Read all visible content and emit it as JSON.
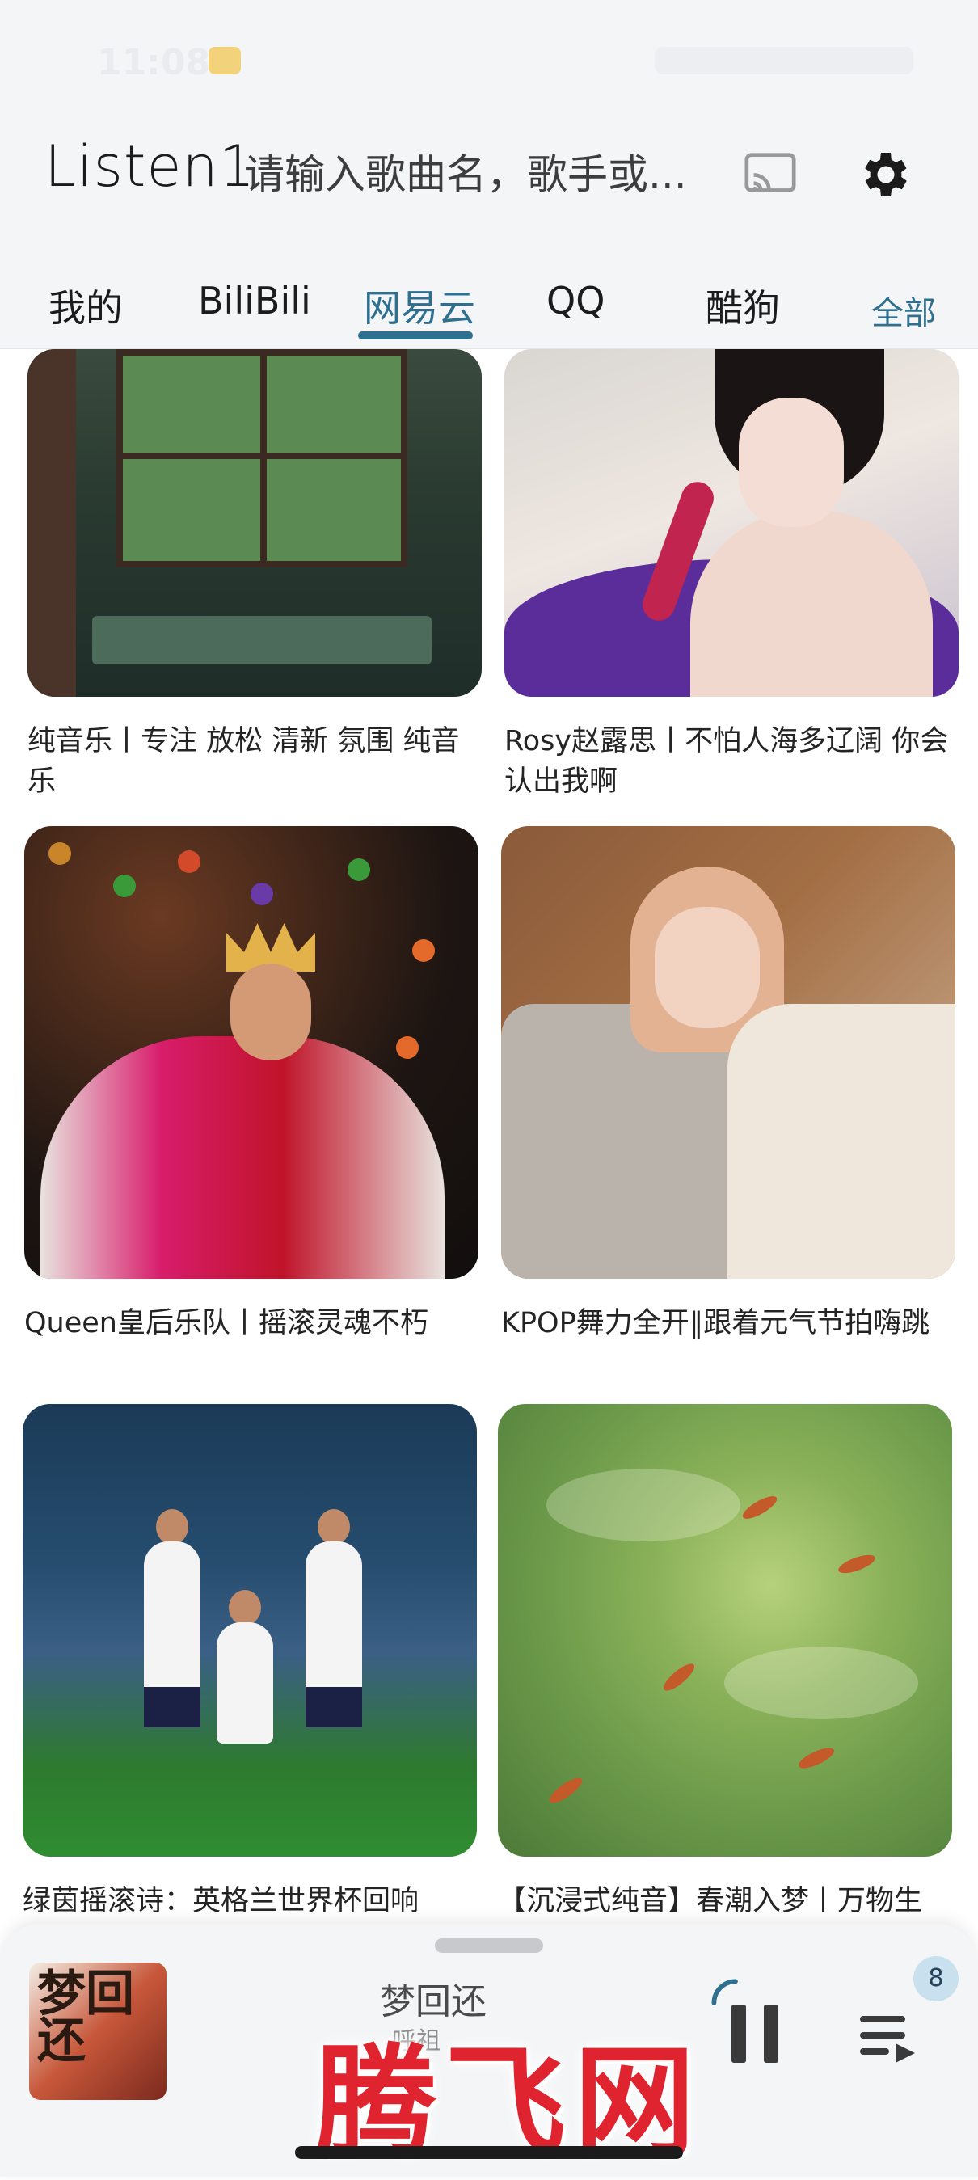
{
  "status_bar": {
    "time": "11:08"
  },
  "header": {
    "app_title": "Listen1",
    "search_placeholder": "请输入歌曲名，歌手或...",
    "cast_icon": "cast-icon",
    "settings_icon": "gear-icon"
  },
  "tabs": {
    "items": [
      {
        "label": "我的"
      },
      {
        "label": "BiliBili"
      },
      {
        "label": "网易云"
      },
      {
        "label": "QQ"
      },
      {
        "label": "酷狗"
      }
    ],
    "active_index": 2,
    "all_label": "全部"
  },
  "playlists": [
    {
      "caption": "纯音乐丨专注 放松 清新 氛围 纯音乐"
    },
    {
      "caption": "Rosy赵露思丨不怕人海多辽阔 你会认出我啊"
    },
    {
      "caption": "Queen皇后乐队丨摇滚灵魂不朽"
    },
    {
      "caption": "KPOP舞力全开‖跟着元气节拍嗨跳"
    },
    {
      "caption": "绿茵摇滚诗：英格兰世界杯回响"
    },
    {
      "caption": "【沉浸式纯音】春潮入梦丨万物生"
    }
  ],
  "player": {
    "song_title": "梦回还",
    "artist": "呼祖",
    "queue_count": "8",
    "cover_text": "梦回还",
    "watermark": "腾飞网"
  },
  "colors": {
    "accent": "#2f6f8f",
    "watermark": "#e0242f"
  }
}
